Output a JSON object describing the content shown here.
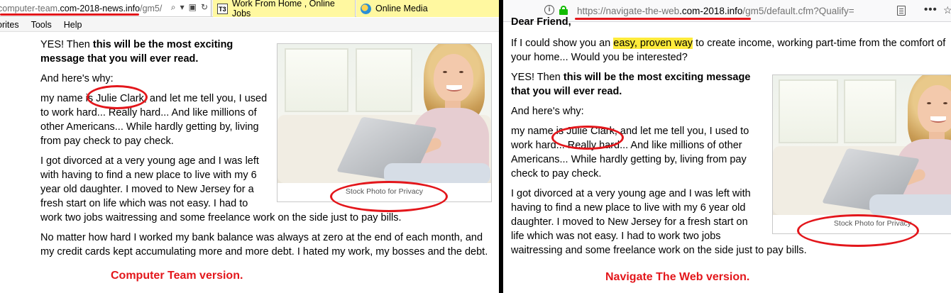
{
  "left": {
    "browser": {
      "url_prefix": "computer-team",
      "url_domain": ".com-2018-news.info",
      "url_path": "/gm5/",
      "tabs": [
        {
          "label": "Work From Home , Online Jobs",
          "icon": "t3-favicon",
          "icon_text": "T3"
        },
        {
          "label": "Online Media",
          "icon": "online-media-favicon"
        }
      ],
      "menu": [
        "orites",
        "Tools",
        "Help"
      ]
    },
    "article": {
      "p1_prefix": "YES! Then ",
      "p1_bold": "this will be the most exciting message that you will ever read.",
      "p2": "And here's why:",
      "p3_prefix": "my name is ",
      "p3_name": "Julie Clark",
      "p3_suffix": ", and let me tell you, I used to work hard... Really hard... And like millions of other Americans... While hardly getting by, living from pay check to pay check.",
      "p4": "I got divorced at a very young age and I was left with having to find a new place to live with my 6 year old daughter. I moved to New Jersey for a fresh start on life which was not easy. I had to work two jobs waitressing and some freelance work on the side just to pay bills.",
      "p5": "No matter how hard I worked my bank balance was always at zero at the end of each month, and my credit cards kept accumulating more and more debt. I hated my work, my bosses and the debt.",
      "photo_caption": "Stock Photo for Privacy"
    },
    "version_label": "Computer Team version."
  },
  "right": {
    "browser": {
      "url_scheme": "https://",
      "url_prefix": "navigate-the-web",
      "url_domain": ".com-2018.info",
      "url_path": "/gm5/default.cfm?Qualify=",
      "info_icon_text": "i",
      "more_icon_text": "•••",
      "bookmark_icon_text": "☆"
    },
    "article": {
      "greeting": "Dear Friend,",
      "p0_prefix": "If I could show you an ",
      "p0_highlight": "easy, proven way",
      "p0_suffix": " to create income, working part-time from the comfort of your home... Would you be interested?",
      "p1_prefix": "YES! Then ",
      "p1_bold": "this will be the most exciting message that you will ever read.",
      "p2": "And here's why:",
      "p3_prefix": "my name is ",
      "p3_name": "Julie Clark",
      "p3_suffix": ", and let me tell you, I used to work hard... Really hard... And like millions of other Americans... While hardly getting by, living from pay check to pay check.",
      "p4": "I got divorced at a very young age and I was left with having to find a new place to live with my 6 year old daughter. I moved to New Jersey for a fresh start on life which was not easy. I had to work two jobs waitressing and some freelance work on the side just to pay bills.",
      "photo_caption": "Stock Photo for Privacy"
    },
    "version_label": "Navigate The Web version."
  },
  "colors": {
    "annotation_red": "#e3161b",
    "tab_yellow": "#fff8a0",
    "highlight_yellow": "#ffeb3b",
    "lock_green": "#12bc00"
  }
}
